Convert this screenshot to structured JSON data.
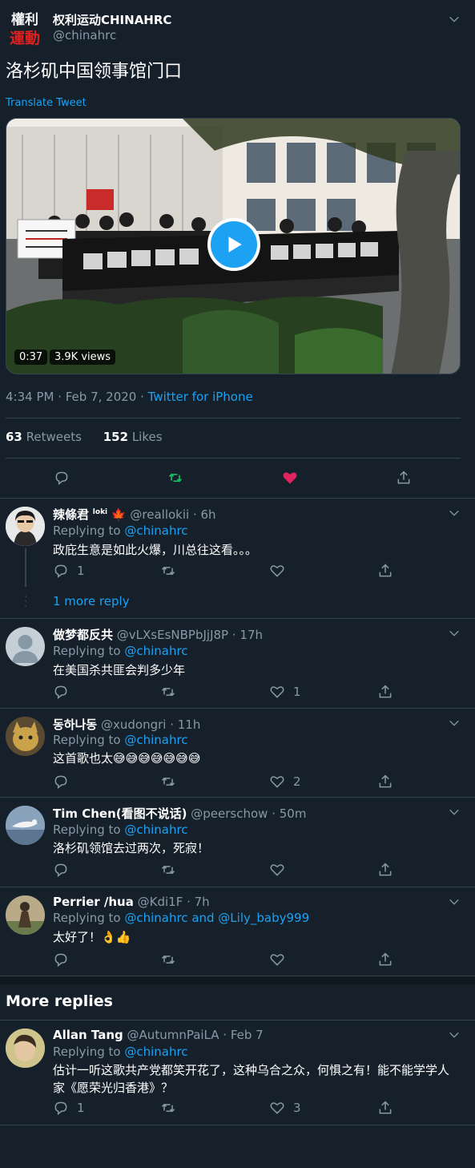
{
  "tweet": {
    "author_name": "权利运动CHINAHRC",
    "author_handle": "@chinahrc",
    "avatar_logo_text": "權利運動",
    "text": "洛杉矶中国领事馆门口",
    "translate_label": "Translate Tweet",
    "video": {
      "duration": "0:37",
      "views": "3.9K views"
    },
    "timestamp": "4:34 PM · Feb 7, 2020 · ",
    "source": "Twitter for iPhone",
    "retweets_count": "63",
    "retweets_label": "Retweets",
    "likes_count": "152",
    "likes_label": "Likes",
    "liked": true,
    "colors": {
      "like": "#e0245e",
      "retweet": "#17bf63",
      "link": "#1da1f2"
    }
  },
  "replies": [
    {
      "name": "辣條君",
      "badge": "loki",
      "flag": "🍁",
      "handle": "@reallokii · 6h",
      "replying_to_label": "Replying to ",
      "replying_to": "@chinahrc",
      "text": "政庇生意是如此火爆，川总往这看。。。",
      "reply_count": "1",
      "like_count": "",
      "more_replies": "1 more reply"
    },
    {
      "name": "做梦都反共",
      "handle": "@vLXsEsNBPbJjJ8P · 17h",
      "replying_to_label": "Replying to ",
      "replying_to": "@chinahrc",
      "text": "在美国杀共匪会判多少年",
      "reply_count": "",
      "like_count": "1"
    },
    {
      "name": "동하나동",
      "handle": "@xudongri · 11h",
      "replying_to_label": "Replying to ",
      "replying_to": "@chinahrc",
      "text": "这首歌也太😅😅😅😅😅😅😅",
      "reply_count": "",
      "like_count": "2"
    },
    {
      "name": "Tim Chen(看图不说话)",
      "handle": "@peerschow · 50m",
      "replying_to_label": "Replying to ",
      "replying_to": "@chinahrc",
      "text": "洛杉矶领馆去过两次，死寂！",
      "reply_count": "",
      "like_count": ""
    },
    {
      "name": "Perrier /hua",
      "handle": "@Kdi1F · 7h",
      "replying_to_label": "Replying to ",
      "replying_to": "@chinahrc and @Lily_baby999",
      "text": "太好了！👌👍",
      "reply_count": "",
      "like_count": ""
    }
  ],
  "more_replies_heading": "More replies",
  "more": [
    {
      "name": "Allan Tang",
      "handle": "@AutumnPaiLA · Feb 7",
      "replying_to_label": "Replying to ",
      "replying_to": "@chinahrc",
      "text": "估计一听这歌共产党都笑开花了，这种乌合之众，何惧之有！能不能学学人家《愿荣光归香港》？",
      "reply_count": "1",
      "like_count": "3"
    }
  ]
}
